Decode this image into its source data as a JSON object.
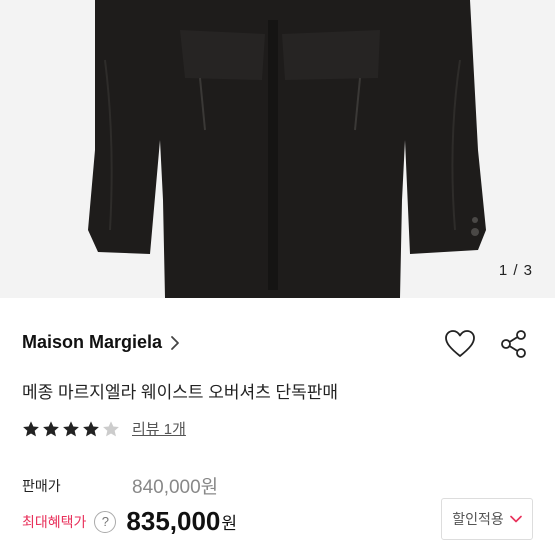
{
  "gallery": {
    "indicator": "1 / 3"
  },
  "product": {
    "brand": "Maison Margiela",
    "title": "메종 마르지엘라 웨이스트 오버셔츠 단독판매",
    "rating": 4,
    "rating_max": 5,
    "review_text": "리뷰 1개"
  },
  "price": {
    "label": "판매가",
    "value": "840,000원"
  },
  "max_discount": {
    "label": "최대혜택가",
    "help": "?",
    "value": "835,000",
    "unit": "원"
  },
  "discount_button": {
    "label": "할인적용"
  },
  "icons": [
    "heart-icon",
    "share-icon",
    "chevron-right-icon",
    "chevron-down-icon",
    "star-icon"
  ],
  "colors": {
    "accent": "#e8315b",
    "star": "#222222",
    "star_empty": "#cccccc"
  }
}
